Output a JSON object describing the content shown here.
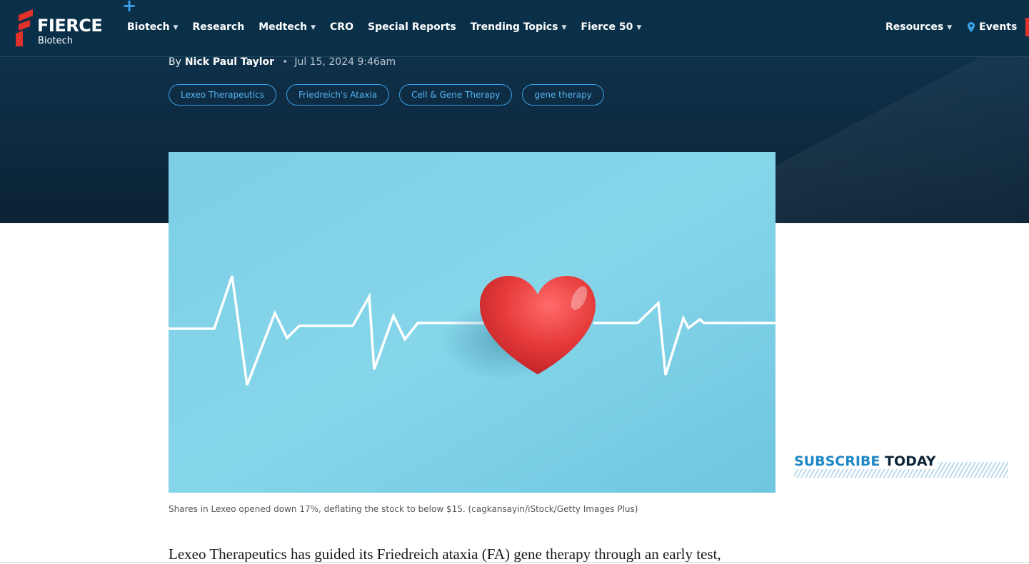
{
  "brand": {
    "name": "FIERCE",
    "sub": "Biotech",
    "colors": {
      "nav_bg": "#0a3049",
      "accent_blue": "#3aa0e8",
      "logo_red": "#e0322b"
    }
  },
  "nav": {
    "items": [
      {
        "label": "Biotech",
        "dropdown": true
      },
      {
        "label": "Research",
        "dropdown": false
      },
      {
        "label": "Medtech",
        "dropdown": true
      },
      {
        "label": "CRO",
        "dropdown": false
      },
      {
        "label": "Special Reports",
        "dropdown": false
      },
      {
        "label": "Trending Topics",
        "dropdown": true
      },
      {
        "label": "Fierce 50",
        "dropdown": true
      }
    ],
    "resources": "Resources",
    "events": "Events",
    "chevron": "⌄"
  },
  "article": {
    "by": "By",
    "author": "Nick Paul Taylor",
    "separator": "•",
    "date": "Jul 15, 2024 9:46am",
    "tags": [
      "Lexeo Therapeutics",
      "Friedreich's Ataxia",
      "Cell & Gene Therapy",
      "gene therapy"
    ],
    "image_caption": "Shares in Lexeo opened down 17%, deflating the stock to below $15. (cagkansayin/iStock/Getty Images Plus)",
    "lead": "Lexeo Therapeutics has guided its Friedreich ataxia (FA) gene therapy through an early test,"
  },
  "sidebar": {
    "subscribe_a": "SUBSCRIBE",
    "subscribe_b": "TODAY"
  }
}
